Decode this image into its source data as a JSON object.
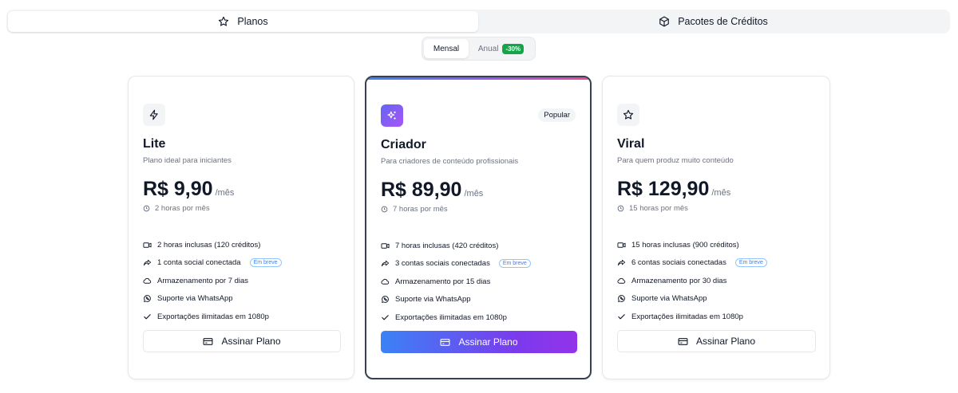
{
  "tabs": [
    {
      "label": "Planos",
      "icon": "star-icon",
      "active": true
    },
    {
      "label": "Pacotes de Créditos",
      "icon": "box-icon",
      "active": false
    }
  ],
  "billing": {
    "monthly": "Mensal",
    "annual": "Anual",
    "discount": "-30%",
    "selected": "monthly"
  },
  "plans": [
    {
      "name": "Lite",
      "icon": "lightning-icon",
      "description": "Plano ideal para iniciantes",
      "price": "R$ 9,90",
      "period": "/mês",
      "hours": "2 horas por mês",
      "popular": false,
      "features": [
        {
          "icon": "video-icon",
          "text": "2 horas inclusas (120 créditos)"
        },
        {
          "icon": "share-icon",
          "text": "1 conta social conectada",
          "badge": "Em breve"
        },
        {
          "icon": "cloud-icon",
          "text": "Armazenamento por 7 dias"
        },
        {
          "icon": "whatsapp-icon",
          "text": "Suporte via WhatsApp"
        },
        {
          "icon": "check-icon",
          "text": "Exportações ilimitadas em 1080p"
        }
      ],
      "cta": "Assinar Plano"
    },
    {
      "name": "Criador",
      "icon": "sparkles-icon",
      "description": "Para criadores de conteúdo profissionais",
      "price": "R$ 89,90",
      "period": "/mês",
      "hours": "7 horas por mês",
      "popular": true,
      "badge": "Popular",
      "features": [
        {
          "icon": "video-icon",
          "text": "7 horas inclusas (420 créditos)"
        },
        {
          "icon": "share-icon",
          "text": "3 contas sociais conectadas",
          "badge": "Em breve"
        },
        {
          "icon": "cloud-icon",
          "text": "Armazenamento por 15 dias"
        },
        {
          "icon": "whatsapp-icon",
          "text": "Suporte via WhatsApp"
        },
        {
          "icon": "check-icon",
          "text": "Exportações ilimitadas em 1080p"
        }
      ],
      "cta": "Assinar Plano"
    },
    {
      "name": "Viral",
      "icon": "star-icon",
      "description": "Para quem produz muito conteúdo",
      "price": "R$ 129,90",
      "period": "/mês",
      "hours": "15 horas por mês",
      "popular": false,
      "features": [
        {
          "icon": "video-icon",
          "text": "15 horas inclusas (900 créditos)"
        },
        {
          "icon": "share-icon",
          "text": "6 contas sociais conectadas",
          "badge": "Em breve"
        },
        {
          "icon": "cloud-icon",
          "text": "Armazenamento por 30 dias"
        },
        {
          "icon": "whatsapp-icon",
          "text": "Suporte via WhatsApp"
        },
        {
          "icon": "check-icon",
          "text": "Exportações ilimitadas em 1080p"
        }
      ],
      "cta": "Assinar Plano"
    }
  ],
  "colors": {
    "accent_gradient_start": "#3b82f6",
    "accent_gradient_end": "#9333ea",
    "discount_green": "#16a34a",
    "badge_blue": "#3b82f6"
  }
}
